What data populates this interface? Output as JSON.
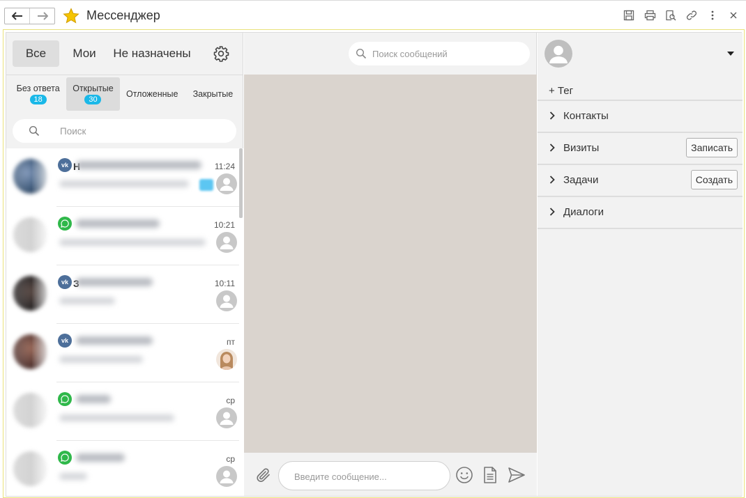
{
  "window": {
    "title": "Мессенджер"
  },
  "filters": [
    {
      "label": "Все",
      "active": true
    },
    {
      "label": "Мои",
      "active": false
    },
    {
      "label": "Не назначены",
      "active": false
    }
  ],
  "statuses": [
    {
      "label": "Без ответа",
      "count": "18",
      "active": false
    },
    {
      "label": "Открытые",
      "count": "30",
      "active": true
    },
    {
      "label": "Отложенные",
      "count": "",
      "active": false
    },
    {
      "label": "Закрытые",
      "count": "",
      "active": false
    }
  ],
  "search": {
    "placeholder": "Поиск"
  },
  "chats": [
    {
      "network": "vk",
      "peek": "Н",
      "time": "11:24",
      "unread": true,
      "avatar": "blurred-photo"
    },
    {
      "network": "whatsapp",
      "peek": "",
      "time": "10:21",
      "unread": false,
      "avatar": "placeholder"
    },
    {
      "network": "vk",
      "peek": "З",
      "time": "10:11",
      "unread": false,
      "avatar": "blurred-photo"
    },
    {
      "network": "vk",
      "peek": "",
      "time": "пт",
      "unread": false,
      "avatar": "blurred-photo"
    },
    {
      "network": "whatsapp",
      "peek": "",
      "time": "ср",
      "unread": false,
      "avatar": "placeholder"
    },
    {
      "network": "whatsapp",
      "peek": "",
      "time": "ср",
      "unread": false,
      "avatar": "placeholder"
    }
  ],
  "messages": {
    "search_placeholder": "Поиск сообщений",
    "input_placeholder": "Введите сообщение..."
  },
  "contact": {
    "add_tag": "+ Тег",
    "sections": [
      {
        "label": "Контакты",
        "button": ""
      },
      {
        "label": "Визиты",
        "button": "Записать"
      },
      {
        "label": "Задачи",
        "button": "Создать"
      },
      {
        "label": "Диалоги",
        "button": ""
      }
    ]
  },
  "colors": {
    "badge": "#1ab8e8",
    "vk": "#4d6f9a",
    "whatsapp": "#2fb84a",
    "chat_background": "#dad4ce",
    "frame_highlight": "#e9e27a"
  }
}
